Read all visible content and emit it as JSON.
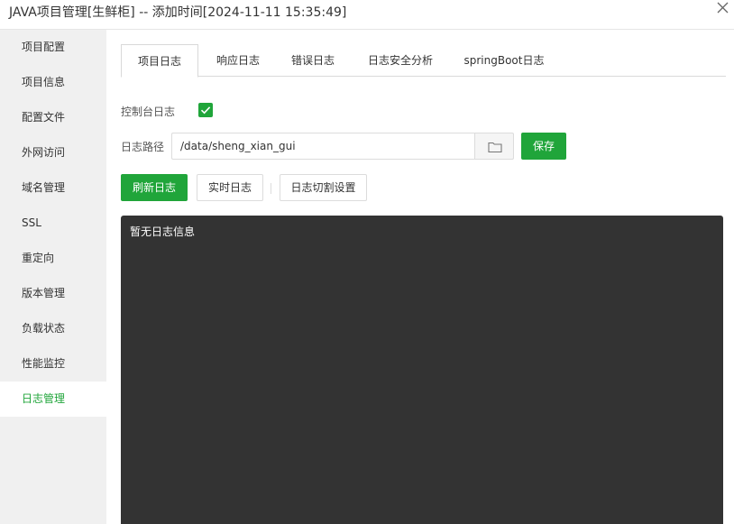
{
  "window": {
    "title": "JAVA项目管理[生鲜柜] -- 添加时间[2024-11-11 15:35:49]"
  },
  "sidebar": {
    "items": [
      {
        "label": "项目配置"
      },
      {
        "label": "项目信息"
      },
      {
        "label": "配置文件"
      },
      {
        "label": "外网访问"
      },
      {
        "label": "域名管理"
      },
      {
        "label": "SSL"
      },
      {
        "label": "重定向"
      },
      {
        "label": "版本管理"
      },
      {
        "label": "负载状态"
      },
      {
        "label": "性能监控"
      },
      {
        "label": "日志管理",
        "active": true
      }
    ]
  },
  "tabs": [
    {
      "label": "项目日志",
      "active": true
    },
    {
      "label": "响应日志"
    },
    {
      "label": "错误日志"
    },
    {
      "label": "日志安全分析"
    },
    {
      "label": "springBoot日志"
    }
  ],
  "form": {
    "console_log_label": "控制台日志",
    "console_log_checked": true,
    "log_path_label": "日志路径",
    "log_path_value": "/data/sheng_xian_gui",
    "save_label": "保存"
  },
  "actions": {
    "refresh_label": "刷新日志",
    "realtime_label": "实时日志",
    "split_settings_label": "日志切割设置"
  },
  "console": {
    "message": "暂无日志信息"
  },
  "colors": {
    "accent": "#20a53a",
    "sidebar_bg": "#f0f0f0",
    "console_bg": "#333333"
  },
  "icons": {
    "close": "close-icon",
    "folder": "folder-icon",
    "check": "check-icon"
  }
}
